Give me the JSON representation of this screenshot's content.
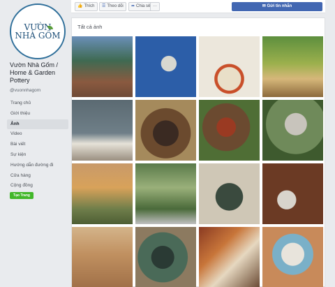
{
  "logo": {
    "line1": "VƯỜN",
    "line2": "NHÀ GỐM"
  },
  "page": {
    "name": "Vườn Nhà Gốm / Home & Garden Pottery",
    "username": "@vuonnhagom"
  },
  "nav": [
    "Trang chủ",
    "Giới thiệu",
    "Ảnh",
    "Video",
    "Bài viết",
    "Sự kiện",
    "Hướng dẫn đường đi",
    "Cửa hàng",
    "Cộng đồng"
  ],
  "nav_active": "Ảnh",
  "create_page": "Tạo Trang",
  "actions": {
    "like": "Thích",
    "follow": "Theo dõi",
    "share": "Chia sẻ",
    "more": "···",
    "message": "Gửi tin nhắn"
  },
  "photos": {
    "title": "Tất cả ảnh"
  },
  "colors": {
    "facebook_blue": "#4267b2",
    "green": "#42b72a",
    "background": "#e9ebee"
  }
}
